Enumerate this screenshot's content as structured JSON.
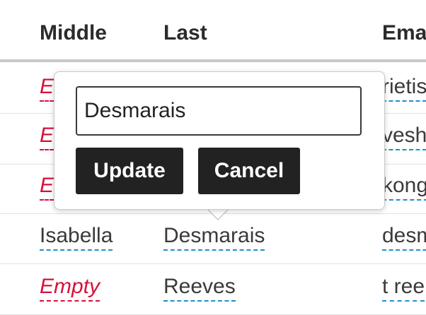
{
  "table": {
    "headers": [
      "Middle",
      "Last",
      "Ema"
    ],
    "rows": [
      {
        "middle": "E",
        "email": "rietis"
      },
      {
        "middle": "E",
        "email": "vesh"
      },
      {
        "middle": "E",
        "email": "kong"
      },
      {
        "middle": "Isabella",
        "last": "Desmarais",
        "email": "desm"
      },
      {
        "middle": "Empty",
        "last": "Reeves",
        "email": "t ree"
      }
    ]
  },
  "editor": {
    "value": "Desmarais",
    "update_label": "Update",
    "cancel_label": "Cancel"
  }
}
